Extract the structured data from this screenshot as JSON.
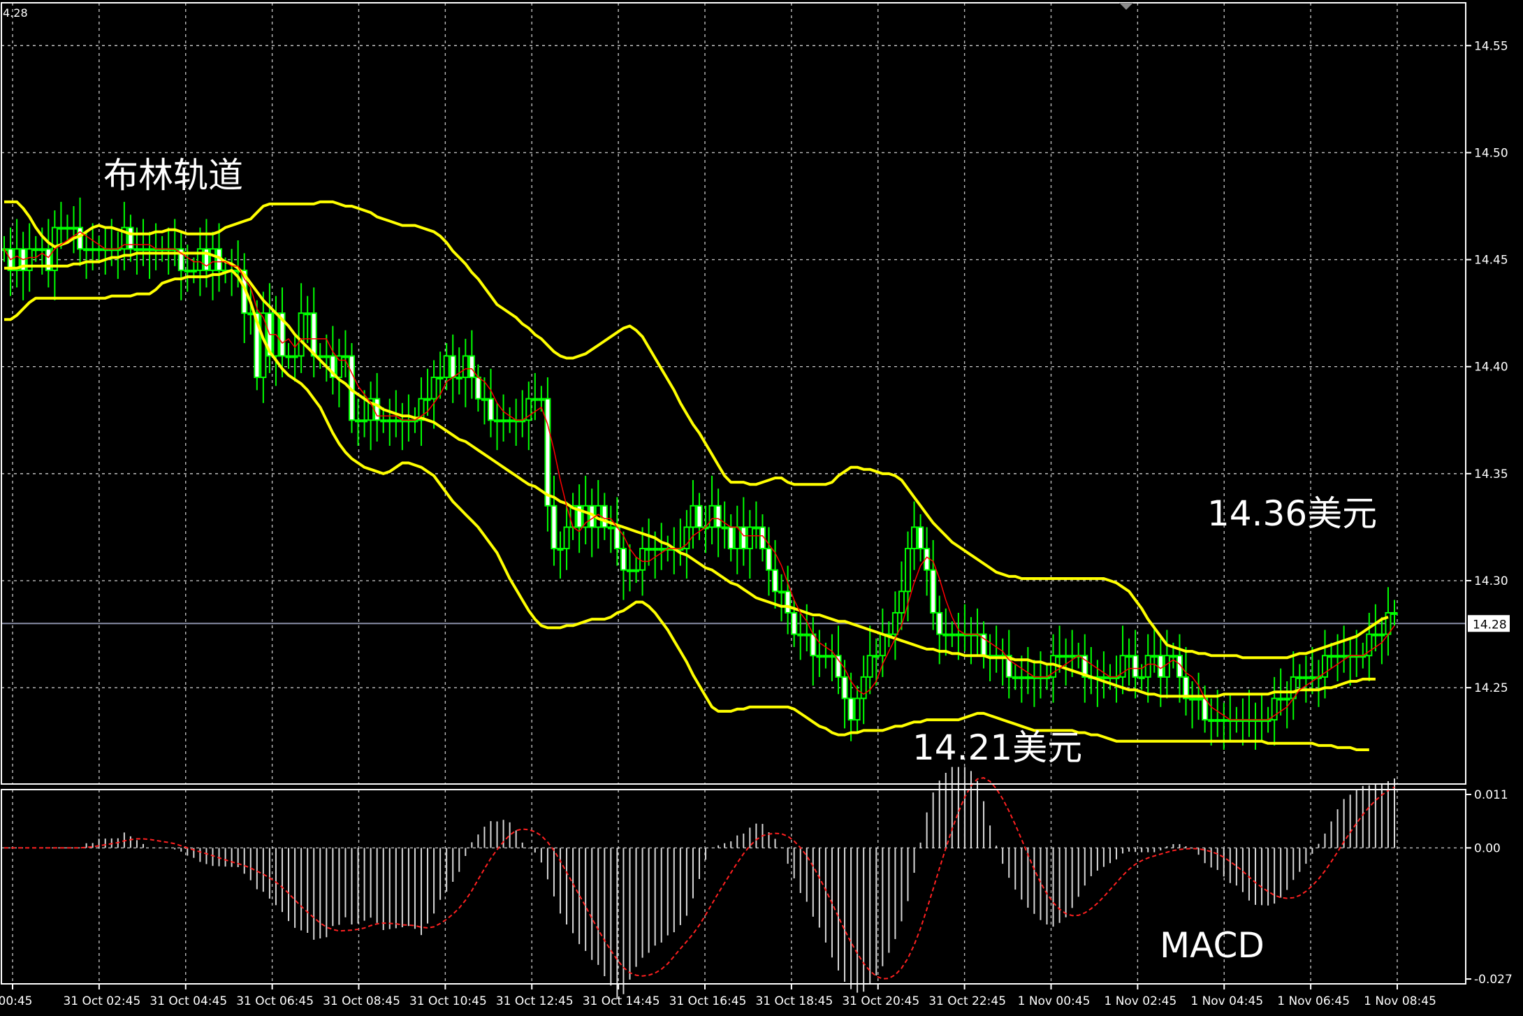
{
  "chart_data": [
    {
      "type": "candlestick",
      "title": "布林轨道",
      "y_ticks": [
        "14.55",
        "14.50",
        "14.45",
        "14.40",
        "14.35",
        "14.30",
        "14.25"
      ],
      "ylim": [
        14.205,
        14.57
      ],
      "top_left_label": "4.28",
      "current_price": "14.28",
      "x_ticks": [
        "00:45",
        "31 Oct 02:45",
        "31 Oct 04:45",
        "31 Oct 06:45",
        "31 Oct 08:45",
        "31 Oct 10:45",
        "31 Oct 12:45",
        "31 Oct 14:45",
        "31 Oct 16:45",
        "31 Oct 18:45",
        "31 Oct 20:45",
        "31 Oct 22:45",
        "1 Nov 00:45",
        "1 Nov 02:45",
        "1 Nov 04:45",
        "1 Nov 06:45",
        "1 Nov 08:45"
      ],
      "annotations": [
        {
          "text": "14.36美元",
          "value": 14.36
        },
        {
          "text": "14.21美元",
          "value": 14.21
        }
      ],
      "colors": {
        "background": "#000000",
        "candle": "#00ff00",
        "bollinger": "#ffff00",
        "ma": "#ff0000",
        "grid": "#ffffff",
        "axis_text": "#ffffff"
      },
      "close": [
        14.455,
        14.445,
        14.455,
        14.445,
        14.455,
        14.455,
        14.455,
        14.445,
        14.465,
        14.465,
        14.465,
        14.465,
        14.455,
        14.455,
        14.455,
        14.455,
        14.455,
        14.455,
        14.455,
        14.465,
        14.455,
        14.455,
        14.455,
        14.455,
        14.455,
        14.455,
        14.455,
        14.455,
        14.445,
        14.445,
        14.445,
        14.455,
        14.445,
        14.455,
        14.445,
        14.445,
        14.445,
        14.445,
        14.425,
        14.425,
        14.395,
        14.425,
        14.405,
        14.425,
        14.405,
        14.405,
        14.405,
        14.425,
        14.425,
        14.405,
        14.405,
        14.405,
        14.395,
        14.405,
        14.405,
        14.375,
        14.375,
        14.375,
        14.385,
        14.375,
        14.375,
        14.375,
        14.375,
        14.375,
        14.375,
        14.375,
        14.385,
        14.385,
        14.395,
        14.395,
        14.405,
        14.395,
        14.395,
        14.405,
        14.395,
        14.385,
        14.385,
        14.375,
        14.375,
        14.375,
        14.375,
        14.375,
        14.375,
        14.385,
        14.385,
        14.385,
        14.335,
        14.315,
        14.315,
        14.325,
        14.335,
        14.325,
        14.335,
        14.325,
        14.335,
        14.325,
        14.325,
        14.315,
        14.305,
        14.305,
        14.305,
        14.315,
        14.315,
        14.315,
        14.315,
        14.315,
        14.315,
        14.315,
        14.325,
        14.335,
        14.325,
        14.325,
        14.335,
        14.325,
        14.325,
        14.315,
        14.325,
        14.315,
        14.325,
        14.325,
        14.315,
        14.305,
        14.295,
        14.295,
        14.285,
        14.275,
        14.275,
        14.275,
        14.265,
        14.265,
        14.265,
        14.265,
        14.255,
        14.245,
        14.235,
        14.245,
        14.255,
        14.265,
        14.265,
        14.275,
        14.275,
        14.285,
        14.295,
        14.315,
        14.325,
        14.315,
        14.305,
        14.285,
        14.275,
        14.275,
        14.275,
        14.275,
        14.275,
        14.275,
        14.275,
        14.265,
        14.265,
        14.265,
        14.265,
        14.255,
        14.255,
        14.255,
        14.255,
        14.255,
        14.255,
        14.255,
        14.265,
        14.265,
        14.265,
        14.265,
        14.265,
        14.255,
        14.255,
        14.255,
        14.255,
        14.255,
        14.255,
        14.265,
        14.265,
        14.255,
        14.255,
        14.265,
        14.265,
        14.255,
        14.265,
        14.265,
        14.255,
        14.245,
        14.245,
        14.245,
        14.235,
        14.235,
        14.235,
        14.235,
        14.235,
        14.235,
        14.235,
        14.235,
        14.235,
        14.235,
        14.235,
        14.245,
        14.245,
        14.245,
        14.255,
        14.255,
        14.255,
        14.255,
        14.255,
        14.265,
        14.265,
        14.265,
        14.265,
        14.265,
        14.265,
        14.265,
        14.275,
        14.275,
        14.275,
        14.285,
        14.285
      ],
      "bollinger_upper": [
        14.477,
        14.477,
        14.477,
        14.474,
        14.47,
        14.465,
        14.461,
        14.458,
        14.456,
        14.457,
        14.458,
        14.46,
        14.461,
        14.463,
        14.465,
        14.466,
        14.465,
        14.465,
        14.464,
        14.463,
        14.462,
        14.462,
        14.462,
        14.462,
        14.463,
        14.463,
        14.464,
        14.464,
        14.463,
        14.462,
        14.462,
        14.462,
        14.462,
        14.462,
        14.463,
        14.465,
        14.466,
        14.467,
        14.468,
        14.469,
        14.472,
        14.475,
        14.476,
        14.476,
        14.476,
        14.476,
        14.476,
        14.476,
        14.476,
        14.476,
        14.477,
        14.477,
        14.477,
        14.476,
        14.475,
        14.475,
        14.474,
        14.473,
        14.472,
        14.47,
        14.469,
        14.468,
        14.467,
        14.466,
        14.466,
        14.466,
        14.465,
        14.464,
        14.463,
        14.461,
        14.458,
        14.454,
        14.451,
        14.448,
        14.444,
        14.441,
        14.437,
        14.433,
        14.429,
        14.427,
        14.425,
        14.423,
        14.42,
        14.418,
        14.415,
        14.413,
        14.41,
        14.407,
        14.405,
        14.404,
        14.404,
        14.405,
        14.406,
        14.408,
        14.41,
        14.412,
        14.414,
        14.416,
        14.418,
        14.419,
        14.417,
        14.414,
        14.409,
        14.404,
        14.399,
        14.394,
        14.389,
        14.383,
        14.378,
        14.373,
        14.369,
        14.364,
        14.359,
        14.354,
        14.349,
        14.346,
        14.346,
        14.346,
        14.345,
        14.345,
        14.346,
        14.347,
        14.348,
        14.348,
        14.346,
        14.345,
        14.345,
        14.345,
        14.345,
        14.345,
        14.345,
        14.346,
        14.349,
        14.351,
        14.353,
        14.353,
        14.352,
        14.352,
        14.351,
        14.35,
        14.35,
        14.349,
        14.347,
        14.343,
        14.339,
        14.335,
        14.331,
        14.327,
        14.324,
        14.321,
        14.318,
        14.316,
        14.314,
        14.312,
        14.31,
        14.308,
        14.306,
        14.304,
        14.303,
        14.302,
        14.302,
        14.301,
        14.301,
        14.301,
        14.301,
        14.301,
        14.301,
        14.301,
        14.301,
        14.301,
        14.301,
        14.301,
        14.301,
        14.301,
        14.301,
        14.3,
        14.299,
        14.297,
        14.295,
        14.291,
        14.287,
        14.282,
        14.278,
        14.274,
        14.27,
        14.269,
        14.268,
        14.267,
        14.267,
        14.266,
        14.266,
        14.265,
        14.265,
        14.265,
        14.265,
        14.265,
        14.264,
        14.264,
        14.264,
        14.264,
        14.264,
        14.264,
        14.264,
        14.264,
        14.265,
        14.266,
        14.266,
        14.267,
        14.268,
        14.269,
        14.27,
        14.271,
        14.272,
        14.273,
        14.274,
        14.276,
        14.278,
        14.28,
        14.282,
        14.283
      ],
      "bollinger_middle": [
        14.446,
        14.446,
        14.446,
        14.447,
        14.447,
        14.447,
        14.447,
        14.447,
        14.447,
        14.447,
        14.447,
        14.448,
        14.448,
        14.449,
        14.449,
        14.449,
        14.45,
        14.451,
        14.451,
        14.452,
        14.452,
        14.453,
        14.453,
        14.453,
        14.453,
        14.453,
        14.453,
        14.453,
        14.453,
        14.453,
        14.453,
        14.453,
        14.453,
        14.452,
        14.451,
        14.449,
        14.448,
        14.446,
        14.443,
        14.439,
        14.435,
        14.431,
        14.428,
        14.425,
        14.422,
        14.419,
        14.415,
        14.412,
        14.409,
        14.406,
        14.403,
        14.4,
        14.397,
        14.394,
        14.392,
        14.389,
        14.387,
        14.385,
        14.383,
        14.382,
        14.38,
        14.379,
        14.378,
        14.377,
        14.377,
        14.376,
        14.376,
        14.375,
        14.374,
        14.372,
        14.37,
        14.368,
        14.366,
        14.365,
        14.363,
        14.361,
        14.359,
        14.357,
        14.355,
        14.353,
        14.351,
        14.349,
        14.347,
        14.345,
        14.344,
        14.342,
        14.34,
        14.339,
        14.337,
        14.336,
        14.334,
        14.333,
        14.332,
        14.331,
        14.329,
        14.328,
        14.327,
        14.326,
        14.325,
        14.324,
        14.323,
        14.322,
        14.321,
        14.32,
        14.318,
        14.317,
        14.315,
        14.313,
        14.312,
        14.31,
        14.308,
        14.306,
        14.305,
        14.303,
        14.301,
        14.299,
        14.298,
        14.296,
        14.294,
        14.292,
        14.291,
        14.29,
        14.289,
        14.288,
        14.288,
        14.287,
        14.286,
        14.285,
        14.284,
        14.284,
        14.283,
        14.282,
        14.281,
        14.281,
        14.28,
        14.279,
        14.278,
        14.277,
        14.276,
        14.275,
        14.274,
        14.273,
        14.272,
        14.271,
        14.27,
        14.269,
        14.268,
        14.268,
        14.267,
        14.267,
        14.266,
        14.266,
        14.265,
        14.265,
        14.265,
        14.265,
        14.264,
        14.264,
        14.264,
        14.264,
        14.263,
        14.263,
        14.263,
        14.262,
        14.262,
        14.261,
        14.261,
        14.26,
        14.259,
        14.258,
        14.257,
        14.256,
        14.255,
        14.254,
        14.253,
        14.252,
        14.251,
        14.25,
        14.249,
        14.249,
        14.248,
        14.247,
        14.247,
        14.246,
        14.246,
        14.246,
        14.246,
        14.246,
        14.246,
        14.246,
        14.246,
        14.246,
        14.246,
        14.247,
        14.247,
        14.247,
        14.247,
        14.247,
        14.247,
        14.247,
        14.247,
        14.248,
        14.248,
        14.248,
        14.248,
        14.249,
        14.249,
        14.249,
        14.249,
        14.25,
        14.25,
        14.251,
        14.252,
        14.253,
        14.253,
        14.254,
        14.254,
        14.254
      ],
      "bollinger_lower": [
        14.422,
        14.422,
        14.424,
        14.427,
        14.43,
        14.432,
        14.432,
        14.432,
        14.432,
        14.432,
        14.432,
        14.432,
        14.432,
        14.432,
        14.432,
        14.432,
        14.432,
        14.433,
        14.433,
        14.433,
        14.433,
        14.434,
        14.434,
        14.434,
        14.436,
        14.439,
        14.44,
        14.441,
        14.441,
        14.442,
        14.442,
        14.442,
        14.442,
        14.443,
        14.443,
        14.444,
        14.445,
        14.442,
        14.437,
        14.43,
        14.421,
        14.413,
        14.407,
        14.403,
        14.399,
        14.396,
        14.394,
        14.392,
        14.389,
        14.385,
        14.381,
        14.375,
        14.369,
        14.364,
        14.36,
        14.357,
        14.355,
        14.353,
        14.352,
        14.351,
        14.35,
        14.351,
        14.353,
        14.355,
        14.355,
        14.354,
        14.353,
        14.351,
        14.349,
        14.345,
        14.341,
        14.337,
        14.334,
        14.331,
        14.328,
        14.325,
        14.321,
        14.317,
        14.313,
        14.307,
        14.301,
        14.296,
        14.291,
        14.286,
        14.282,
        14.279,
        14.278,
        14.278,
        14.278,
        14.279,
        14.279,
        14.28,
        14.281,
        14.282,
        14.282,
        14.282,
        14.283,
        14.285,
        14.286,
        14.288,
        14.29,
        14.29,
        14.288,
        14.285,
        14.281,
        14.277,
        14.272,
        14.267,
        14.262,
        14.256,
        14.251,
        14.246,
        14.241,
        14.239,
        14.239,
        14.239,
        14.24,
        14.24,
        14.241,
        14.241,
        14.241,
        14.241,
        14.241,
        14.241,
        14.241,
        14.24,
        14.238,
        14.236,
        14.234,
        14.232,
        14.231,
        14.229,
        14.228,
        14.228,
        14.229,
        14.229,
        14.23,
        14.23,
        14.23,
        14.23,
        14.231,
        14.232,
        14.232,
        14.233,
        14.234,
        14.234,
        14.235,
        14.235,
        14.235,
        14.235,
        14.235,
        14.235,
        14.236,
        14.237,
        14.238,
        14.238,
        14.237,
        14.236,
        14.235,
        14.234,
        14.233,
        14.232,
        14.231,
        14.23,
        14.23,
        14.23,
        14.23,
        14.23,
        14.23,
        14.23,
        14.229,
        14.229,
        14.228,
        14.228,
        14.227,
        14.226,
        14.225,
        14.225,
        14.225,
        14.225,
        14.225,
        14.225,
        14.225,
        14.225,
        14.225,
        14.225,
        14.225,
        14.225,
        14.225,
        14.225,
        14.225,
        14.225,
        14.225,
        14.225,
        14.225,
        14.225,
        14.225,
        14.225,
        14.225,
        14.225,
        14.224,
        14.224,
        14.224,
        14.224,
        14.224,
        14.224,
        14.224,
        14.224,
        14.223,
        14.223,
        14.223,
        14.222,
        14.222,
        14.222,
        14.221,
        14.221,
        14.221
      ]
    },
    {
      "type": "bar",
      "title": "MACD",
      "y_ticks": [
        "0.011",
        "0.00",
        "-0.027"
      ],
      "ylim": [
        -0.028,
        0.012
      ]
    }
  ]
}
